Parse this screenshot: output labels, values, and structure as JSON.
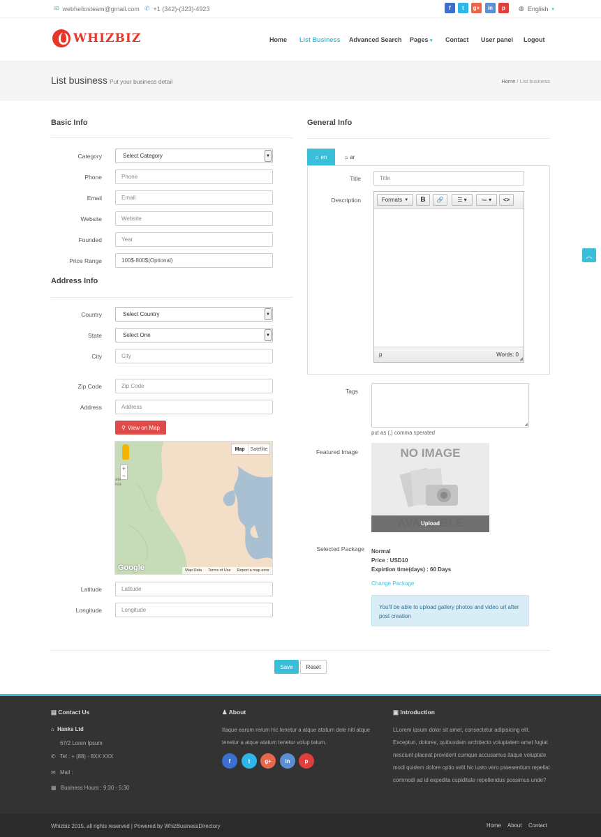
{
  "topbar": {
    "email": "webheliosteam@gmail.com",
    "phone": "+1 (342)-(323)-4923",
    "language": "English",
    "social": [
      "f",
      "t",
      "g+",
      "in",
      "p"
    ]
  },
  "header": {
    "logo": "WHIZBIZ",
    "nav": [
      "Home",
      "List Business",
      "Advanced Search",
      "Pages",
      "Contact",
      "User panel",
      "Logout"
    ],
    "active_nav": "List Business"
  },
  "titlebar": {
    "title": "List business",
    "subtitle": "Put your business detail",
    "breadcrumb_home": "Home",
    "breadcrumb_sep": "/",
    "breadcrumb_current": "List business"
  },
  "basic": {
    "heading": "Basic Info",
    "category_label": "Category",
    "category_value": "Select Category",
    "phone_label": "Phone",
    "phone_ph": "Phone",
    "email_label": "Email",
    "email_ph": "Email",
    "website_label": "Website",
    "website_ph": "Website",
    "founded_label": "Founded",
    "founded_ph": "Year",
    "price_label": "Price Range",
    "price_ph": "100$-800$(Optional)"
  },
  "address": {
    "heading": "Address Info",
    "country_label": "Country",
    "country_value": "Select Country",
    "state_label": "State",
    "state_value": "Select One",
    "city_label": "City",
    "city_ph": "City",
    "zip_label": "Zip Code",
    "zip_ph": "Zip Code",
    "address_label": "Address",
    "address_ph": "Address",
    "view_map": "View on Map",
    "map_btn_map": "Map",
    "map_btn_satellite": "Satellite",
    "map_google": "Google",
    "map_data": "Map Data",
    "map_terms": "Terms of Use",
    "map_report": "Report a map error",
    "lat_label": "Latitude",
    "lat_ph": "Latitude",
    "lng_label": "Longitude",
    "lng_ph": "Longitude"
  },
  "general": {
    "heading": "General Info",
    "tab_en": "en",
    "tab_ar": "ar",
    "title_label": "Title",
    "title_ph": "Title",
    "desc_label": "Description",
    "editor_formats": "Formats",
    "editor_bold": "B",
    "editor_path": "p",
    "editor_words": "Words: 0",
    "tags_label": "Tags",
    "tags_hint": "put as (,) comma sperated",
    "image_label": "Featured Image",
    "image_text_1": "NO IMAGE",
    "image_text_2": "AVAILABLE",
    "upload": "Upload",
    "package_label": "Selected Package",
    "package_name": "Normal",
    "package_price": "Price : USD10",
    "package_expiry": "Expirtion time(days) : 60 Days",
    "change_package": "Change Package",
    "info_note": "You'll be able to upload gallery photos and video url after post creation"
  },
  "actions": {
    "save": "Save",
    "reset": "Reset"
  },
  "footer": {
    "contact_heading": "Contact Us",
    "company": "Hanks Ltd",
    "address": "67/2 Loren Ipsum",
    "tel": "Tel : + (88) - 8XX XXX",
    "mail": "Mail :",
    "hours": "Business Hours : 9:30 - 5:30",
    "about_heading": "About",
    "about_text": "Itaque earum rerum hic tenetur a atque atatum dele niti atque tenetur a atque atatum tenetur volup tatum.",
    "intro_heading": "Introduction",
    "intro_text": "LLorem ipsum dolor sit amet, consectetur adipisicing elit. Excepturi, dolores, quibusdam architecto voluptatem amet fugiat nesciunt placeat provident cumque accusamus itaque voluptate modi quidem dolore optio velit hic iusto vero praesentium repellat commodi ad id expedita cupiditate repellendus possimus unde?",
    "copyright": "Whizbiz 2015, all rights reserved | Powered by WhizBusinessDirectory",
    "links": [
      "Home",
      "About",
      "Contact"
    ]
  },
  "colors": {
    "accent": "#3bbfd9",
    "brand": "#e8352a",
    "danger": "#e04b4a",
    "facebook": "#3b6fd1",
    "twitter": "#2fb6e8",
    "google": "#e8674b",
    "linkedin": "#5a8fd6",
    "pinterest": "#e0403c"
  }
}
